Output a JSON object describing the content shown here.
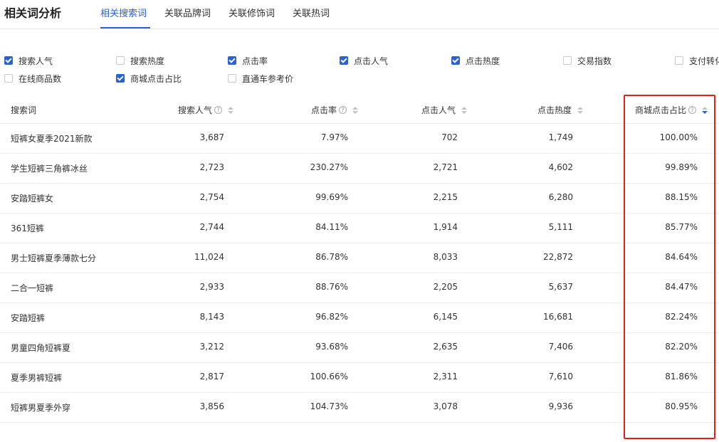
{
  "header": {
    "title": "相关词分析",
    "tabs": [
      {
        "label": "相关搜索词",
        "active": true
      },
      {
        "label": "关联品牌词",
        "active": false
      },
      {
        "label": "关联修饰词",
        "active": false
      },
      {
        "label": "关联热词",
        "active": false
      }
    ]
  },
  "metrics": [
    {
      "label": "搜索人气",
      "checked": true
    },
    {
      "label": "搜索热度",
      "checked": false
    },
    {
      "label": "点击率",
      "checked": true
    },
    {
      "label": "点击人气",
      "checked": true
    },
    {
      "label": "点击热度",
      "checked": true
    },
    {
      "label": "交易指数",
      "checked": false
    },
    {
      "label": "支付转化",
      "checked": false
    },
    {
      "label": "在线商品数",
      "checked": false
    },
    {
      "label": "商城点击占比",
      "checked": true
    },
    {
      "label": "直通车参考价",
      "checked": false
    }
  ],
  "table": {
    "columns": [
      "搜索词",
      "搜索人气",
      "点击率",
      "点击人气",
      "点击热度",
      "商城点击占比"
    ],
    "rows": [
      [
        "短裤女夏季2021新款",
        "3,687",
        "7.97%",
        "702",
        "1,749",
        "100.00%"
      ],
      [
        "学生短裤三角裤冰丝",
        "2,723",
        "230.27%",
        "2,721",
        "4,602",
        "99.89%"
      ],
      [
        "安踏短裤女",
        "2,754",
        "99.69%",
        "2,215",
        "6,280",
        "88.15%"
      ],
      [
        "361短裤",
        "2,744",
        "84.11%",
        "1,914",
        "5,111",
        "85.77%"
      ],
      [
        "男士短裤夏季薄款七分",
        "11,024",
        "86.78%",
        "8,033",
        "22,872",
        "84.64%"
      ],
      [
        "二合一短裤",
        "2,933",
        "88.76%",
        "2,205",
        "5,637",
        "84.47%"
      ],
      [
        "安踏短裤",
        "8,143",
        "96.82%",
        "6,145",
        "16,681",
        "82.24%"
      ],
      [
        "男童四角短裤夏",
        "3,212",
        "93.68%",
        "2,635",
        "7,406",
        "82.20%"
      ],
      [
        "夏季男裤短裤",
        "2,817",
        "100.66%",
        "2,311",
        "7,610",
        "81.86%"
      ],
      [
        "短裤男夏季外穿",
        "3,856",
        "104.73%",
        "3,078",
        "9,936",
        "80.95%"
      ]
    ]
  },
  "colors": {
    "accent": "#2a62d6",
    "highlight": "#e0221c"
  }
}
